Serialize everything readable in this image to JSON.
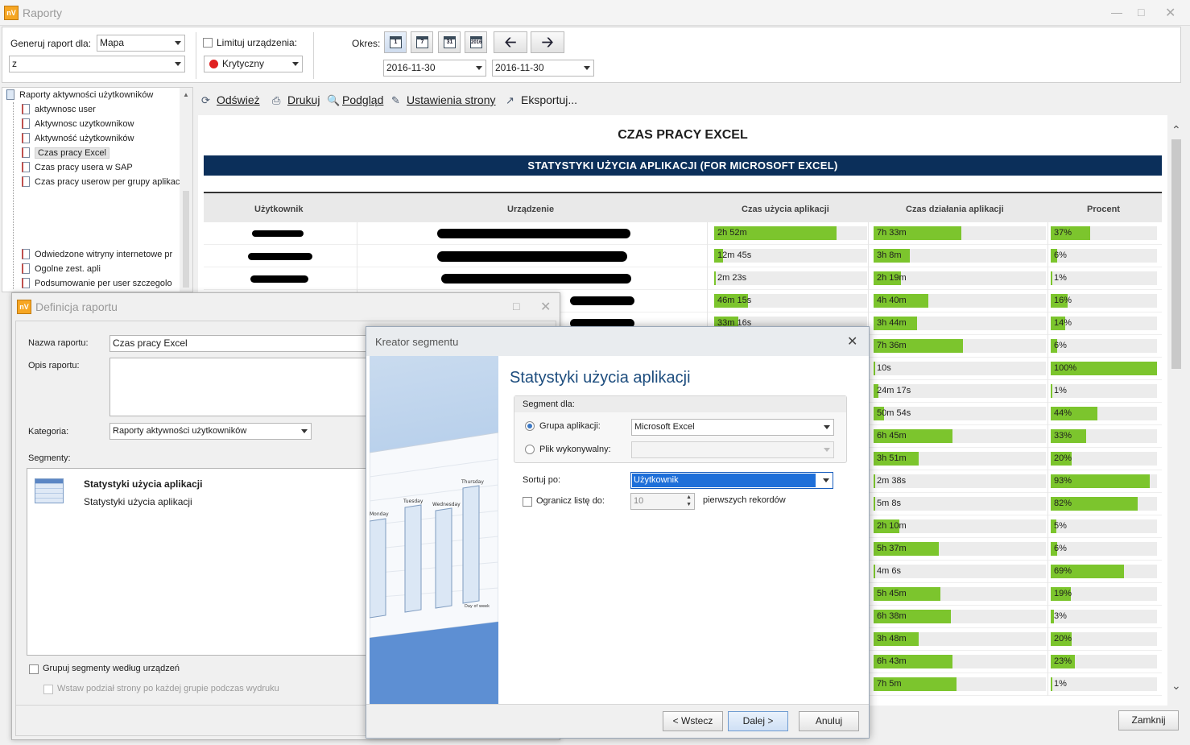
{
  "app": {
    "title": "Raporty",
    "logo_text": "nV"
  },
  "toolbar": {
    "generate_label": "Generuj raport dla:",
    "generate_value": "Mapa",
    "second_value": "z",
    "limits_label": "Limituj urządzenia:",
    "limits_value": "Krytyczny",
    "period_label": "Okres:",
    "cal_icons": [
      "1",
      "7",
      "31",
      "2016"
    ],
    "date_from": "2016-11-30",
    "date_to": "2016-11-30"
  },
  "tree": {
    "root": "Raporty aktywności użytkowników",
    "items": [
      "aktywnosc user",
      "Aktywnosc uzytkownikow",
      "Aktywność użytkowników",
      "Czas pracy Excel",
      "Czas pracy usera w SAP",
      "Czas pracy userow per grupy aplikacji",
      "Odwiedzone witryny internetowe pr",
      "Ogolne zest. apli",
      "Podsumowanie per user szczegolo"
    ]
  },
  "report_toolbar": {
    "refresh": "Odśwież",
    "print": "Drukuj",
    "preview": "Podgląd",
    "page_setup": "Ustawienia strony",
    "export": "Eksportuj..."
  },
  "report": {
    "title": "CZAS PRACY EXCEL",
    "banner": "STATYSTYKI UŻYCIA APLIKACJI (FOR MICROSOFT EXCEL)",
    "columns": [
      "Użytkownik",
      "Urządzenie",
      "Czas użycia aplikacji",
      "Czas działania aplikacji",
      "Procent"
    ],
    "rows": [
      {
        "usage": "2h 52m",
        "usage_frac": 0.8,
        "runtime": "7h 33m",
        "runtime_frac": 0.51,
        "pct": "37%",
        "pct_frac": 0.37
      },
      {
        "usage": "12m 45s",
        "usage_frac": 0.06,
        "runtime": "3h 8m",
        "runtime_frac": 0.21,
        "pct": "6%",
        "pct_frac": 0.06
      },
      {
        "usage": "2m 23s",
        "usage_frac": 0.01,
        "runtime": "2h 19m",
        "runtime_frac": 0.16,
        "pct": "1%",
        "pct_frac": 0.01
      },
      {
        "usage": "46m 15s",
        "usage_frac": 0.22,
        "runtime": "4h 40m",
        "runtime_frac": 0.32,
        "pct": "16%",
        "pct_frac": 0.16
      },
      {
        "usage": "33m 16s",
        "usage_frac": 0.16,
        "runtime": "3h 44m",
        "runtime_frac": 0.25,
        "pct": "14%",
        "pct_frac": 0.14
      },
      {
        "usage": "",
        "usage_frac": 0,
        "runtime": "7h 36m",
        "runtime_frac": 0.52,
        "pct": "6%",
        "pct_frac": 0.06
      },
      {
        "usage": "",
        "usage_frac": 0,
        "runtime": "10s",
        "runtime_frac": 0.0,
        "pct": "100%",
        "pct_frac": 1.0
      },
      {
        "usage": "",
        "usage_frac": 0,
        "runtime": "24m 17s",
        "runtime_frac": 0.03,
        "pct": "1%",
        "pct_frac": 0.01
      },
      {
        "usage": "",
        "usage_frac": 0,
        "runtime": "50m 54s",
        "runtime_frac": 0.06,
        "pct": "44%",
        "pct_frac": 0.44
      },
      {
        "usage": "",
        "usage_frac": 0,
        "runtime": "6h 45m",
        "runtime_frac": 0.46,
        "pct": "33%",
        "pct_frac": 0.33
      },
      {
        "usage": "",
        "usage_frac": 0,
        "runtime": "3h 51m",
        "runtime_frac": 0.26,
        "pct": "20%",
        "pct_frac": 0.2
      },
      {
        "usage": "",
        "usage_frac": 0,
        "runtime": "2m 38s",
        "runtime_frac": 0.0,
        "pct": "93%",
        "pct_frac": 0.93
      },
      {
        "usage": "",
        "usage_frac": 0,
        "runtime": "5m 8s",
        "runtime_frac": 0.0,
        "pct": "82%",
        "pct_frac": 0.82
      },
      {
        "usage": "",
        "usage_frac": 0,
        "runtime": "2h 10m",
        "runtime_frac": 0.15,
        "pct": "5%",
        "pct_frac": 0.05
      },
      {
        "usage": "",
        "usage_frac": 0,
        "runtime": "5h 37m",
        "runtime_frac": 0.38,
        "pct": "6%",
        "pct_frac": 0.06
      },
      {
        "usage": "",
        "usage_frac": 0,
        "runtime": "4m 6s",
        "runtime_frac": 0.0,
        "pct": "69%",
        "pct_frac": 0.69
      },
      {
        "usage": "",
        "usage_frac": 0,
        "runtime": "5h 45m",
        "runtime_frac": 0.39,
        "pct": "19%",
        "pct_frac": 0.19
      },
      {
        "usage": "",
        "usage_frac": 0,
        "runtime": "6h 38m",
        "runtime_frac": 0.45,
        "pct": "3%",
        "pct_frac": 0.03
      },
      {
        "usage": "",
        "usage_frac": 0,
        "runtime": "3h 48m",
        "runtime_frac": 0.26,
        "pct": "20%",
        "pct_frac": 0.2
      },
      {
        "usage": "",
        "usage_frac": 0,
        "runtime": "6h 43m",
        "runtime_frac": 0.46,
        "pct": "23%",
        "pct_frac": 0.23
      },
      {
        "usage": "",
        "usage_frac": 0,
        "runtime": "7h 5m",
        "runtime_frac": 0.48,
        "pct": "1%",
        "pct_frac": 0.01
      }
    ]
  },
  "close_button": "Zamknij",
  "definition_dialog": {
    "title": "Definicja raportu",
    "name_label": "Nazwa raportu:",
    "name_value": "Czas pracy Excel",
    "desc_label": "Opis raportu:",
    "category_label": "Kategoria:",
    "category_value": "Raporty aktywności użytkowników",
    "segments_label": "Segmenty:",
    "segment_title": "Statystyki użycia aplikacji",
    "segment_sub": "Statystyki użycia aplikacji",
    "group_label": "Grupuj segmenty według urządzeń",
    "pagebreak_label": "Wstaw podział strony po każdej grupie podczas wydruku"
  },
  "segment_wizard": {
    "title": "Kreator segmentu",
    "heading": "Statystyki użycia aplikacji",
    "segment_for": "Segment dla:",
    "app_group_label": "Grupa aplikacji:",
    "app_group_value": "Microsoft Excel",
    "exe_label": "Plik wykonywalny:",
    "sort_label": "Sortuj po:",
    "sort_value": "Użytkownik",
    "limit_label": "Ogranicz listę do:",
    "limit_value": "10",
    "limit_suffix": "pierwszych rekordów",
    "back": "< Wstecz",
    "next": "Dalej >",
    "cancel": "Anuluj",
    "chart_days": [
      "Monday",
      "Tuesday",
      "Wednesday",
      "Thursday"
    ],
    "chart_axis": "Day of week"
  },
  "colors": {
    "banner": "#0b2f5a",
    "bar": "#7cc52d",
    "accent": "#1e6fd9"
  }
}
